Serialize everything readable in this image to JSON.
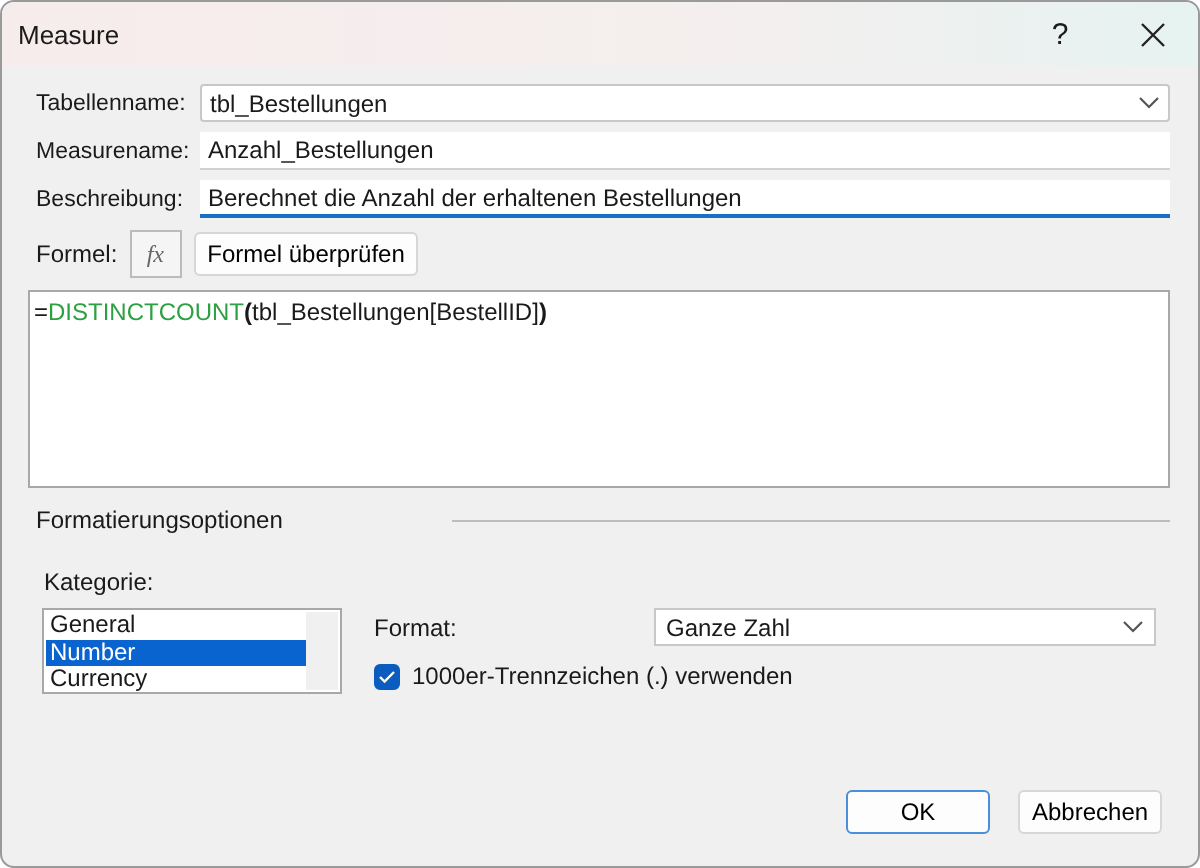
{
  "window": {
    "title": "Measure",
    "help": "?"
  },
  "fields": [
    {
      "label": "Tabellenname:",
      "value": "tbl_Bestellungen",
      "kind": "dropdown",
      "focused": false
    },
    {
      "label": "Measurename:",
      "value": "Anzahl_Bestellungen",
      "kind": "text",
      "focused": false
    },
    {
      "label": "Beschreibung:",
      "value": "Berechnet die Anzahl der erhaltenen Bestellungen",
      "kind": "text",
      "focused": true
    }
  ],
  "formula": {
    "label": "Formel:",
    "fx": "fx",
    "check_button": "Formel überprüfen",
    "tokens": [
      {
        "text": "=",
        "kind": "plain"
      },
      {
        "text": "DISTINCTCOUNT",
        "kind": "function"
      },
      {
        "text": "(",
        "kind": "paren"
      },
      {
        "text": "tbl_Bestellungen[BestellID]",
        "kind": "plain"
      },
      {
        "text": ")",
        "kind": "paren"
      }
    ]
  },
  "format_options": {
    "title": "Formatierungsoptionen",
    "category_label": "Kategorie:",
    "categories": [
      {
        "label": "General",
        "selected": false
      },
      {
        "label": "Number",
        "selected": true
      },
      {
        "label": "Currency",
        "selected": false
      }
    ],
    "format_label": "Format:",
    "format_value": "Ganze Zahl",
    "separator": {
      "label": "1000er-Trennzeichen (.) verwenden",
      "checked": true
    }
  },
  "buttons": [
    {
      "label": "OK",
      "default": true
    },
    {
      "label": "Abbrechen",
      "default": false
    }
  ]
}
